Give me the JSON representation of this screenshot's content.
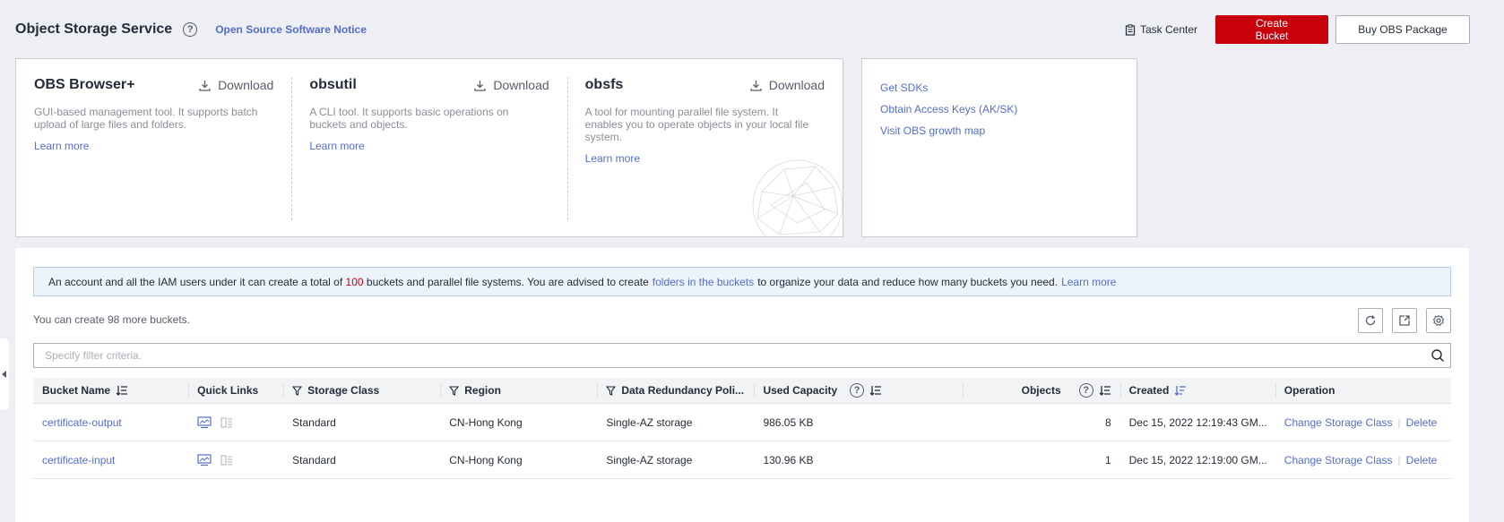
{
  "header": {
    "title": "Object Storage Service",
    "oss_notice": "Open Source Software Notice",
    "task_center": "Task Center",
    "create_bucket": "Create Bucket",
    "buy_package": "Buy OBS Package"
  },
  "tools": [
    {
      "name": "OBS Browser+",
      "download": "Download",
      "desc": "GUI-based management tool. It supports batch upload of large files and folders.",
      "learn": "Learn more"
    },
    {
      "name": "obsutil",
      "download": "Download",
      "desc": "A CLI tool. It supports basic operations on buckets and objects.",
      "learn": "Learn more"
    },
    {
      "name": "obsfs",
      "download": "Download",
      "desc": "A tool for mounting parallel file system. It enables you to operate objects in your local file system.",
      "learn": "Learn more"
    }
  ],
  "links": [
    "Get SDKs",
    "Obtain Access Keys (AK/SK)",
    "Visit OBS growth map"
  ],
  "notice": {
    "part1": "An account and all the IAM users under it can create a total of",
    "count": "100",
    "part2": "buckets and parallel file systems. You are advised to create",
    "link1": "folders in the buckets",
    "part3": "to organize your data and reduce how many buckets you need.",
    "link2": "Learn more"
  },
  "quota_text": "You can create 98 more buckets.",
  "filter_placeholder": "Specify filter criteria.",
  "columns": {
    "bucket_name": "Bucket Name",
    "quick_links": "Quick Links",
    "storage_class": "Storage Class",
    "region": "Region",
    "redundancy": "Data Redundancy Poli...",
    "used_capacity": "Used Capacity",
    "objects": "Objects",
    "created": "Created",
    "operation": "Operation"
  },
  "rows": [
    {
      "name": "certificate-output",
      "storage": "Standard",
      "region": "CN-Hong Kong",
      "redundancy": "Single-AZ storage",
      "capacity": "986.05 KB",
      "objects": "8",
      "created": "Dec 15, 2022 12:19:43 GM...",
      "op1": "Change Storage Class",
      "op2": "Delete"
    },
    {
      "name": "certificate-input",
      "storage": "Standard",
      "region": "CN-Hong Kong",
      "redundancy": "Single-AZ storage",
      "capacity": "130.96 KB",
      "objects": "1",
      "created": "Dec 15, 2022 12:19:00 GM...",
      "op1": "Change Storage Class",
      "op2": "Delete"
    }
  ],
  "colors": {
    "primary": "#c7000b",
    "link": "#526ecc"
  }
}
